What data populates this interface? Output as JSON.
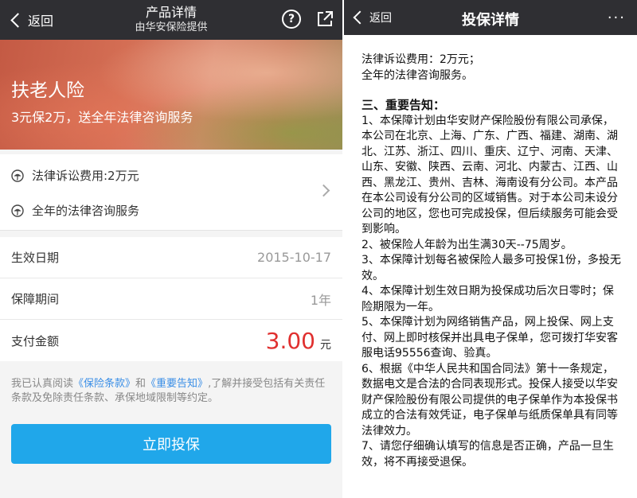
{
  "left": {
    "nav": {
      "back_label": "返回",
      "title": "产品详情",
      "subtitle": "由华安保险提供",
      "help_glyph": "?"
    },
    "banner": {
      "title": "扶老人险",
      "subtitle": "3元保2万，送全年法律咨询服务"
    },
    "features": [
      {
        "text": "法律诉讼费用:2万元",
        "icon": "umbrella-icon"
      },
      {
        "text": "全年的法律咨询服务",
        "icon": "umbrella-icon"
      }
    ],
    "rows": [
      {
        "label": "生效日期",
        "value": "2015-10-17"
      },
      {
        "label": "保障期间",
        "value": "1年"
      }
    ],
    "payment": {
      "label": "支付金额",
      "amount": "3.00",
      "unit": "元"
    },
    "agreement": {
      "prefix": "我已认真阅读",
      "link1": "《保险条款》",
      "and": "和",
      "link2": "《重要告知》",
      "suffix": ",了解并接受包括有关责任条款及免除责任条款、承保地域限制等约定。"
    },
    "cta_label": "立即投保"
  },
  "right": {
    "nav": {
      "back_label": "返回",
      "title": "投保详情",
      "more_glyph": "···"
    },
    "doc": {
      "intro_lines": [
        "法律诉讼费用：2万元；",
        "全年的法律咨询服务。"
      ],
      "heading": "三、重要告知：",
      "items": [
        "1、本保障计划由华安财产保险股份有限公司承保，本公司在北京、上海、广东、广西、福建、湖南、湖北、江苏、浙江、四川、重庆、辽宁、河南、天津、山东、安徽、陕西、云南、河北、内蒙古、江西、山西、黑龙江、贵州、吉林、海南设有分公司。本产品在本公司设有分公司的区域销售。对于本公司未设分公司的地区，您也可完成投保，但后续服务可能会受到影响。",
        "2、被保险人年龄为出生满30天--75周岁。",
        "3、本保障计划每名被保险人最多可投保1份，多投无效。",
        "4、本保障计划生效日期为投保成功后次日零时；保险期限为一年。",
        "5、本保障计划为网络销售产品，网上投保、网上支付、网上即时核保并出具电子保单，您可拨打华安客服电话95556查询、验真。",
        "6、根据《中华人民共和国合同法》第十一条规定，数据电文是合法的合同表现形式。投保人接受以华安财产保险股份有限公司提供的电子保单作为本投保书成立的合法有效凭证，电子保单与纸质保单具有同等法律效力。",
        "7、请您仔细确认填写的信息是否正确，产品一旦生效，将不再接受退保。"
      ]
    }
  },
  "colors": {
    "nav_bg": "#2f2f33",
    "cta_bg": "#20a7ea",
    "amount": "#e0302f",
    "link": "#3a8ee6"
  }
}
